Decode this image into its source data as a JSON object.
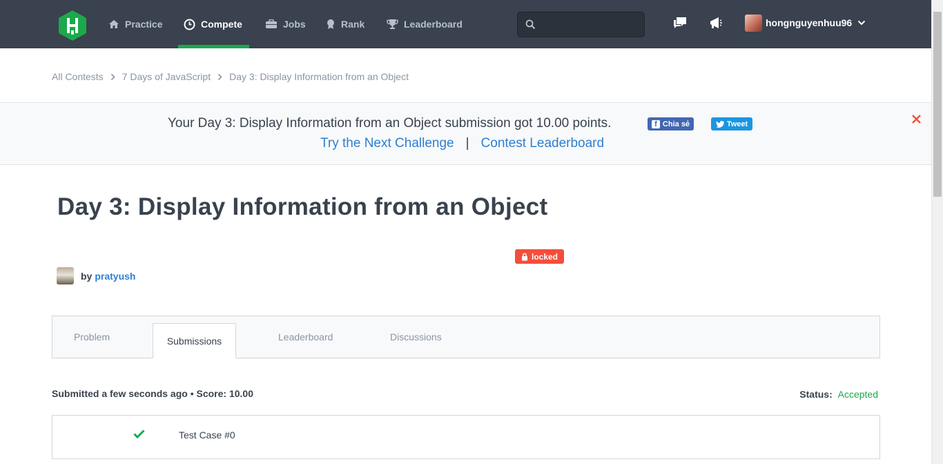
{
  "nav": {
    "items": [
      {
        "label": "Practice",
        "icon": "home-icon"
      },
      {
        "label": "Compete",
        "icon": "clock-icon"
      },
      {
        "label": "Jobs",
        "icon": "briefcase-icon"
      },
      {
        "label": "Rank",
        "icon": "medal-icon"
      },
      {
        "label": "Leaderboard",
        "icon": "trophy-icon"
      }
    ],
    "active": "Compete",
    "search_value": "",
    "username": "hongnguyenhuu96"
  },
  "breadcrumb": [
    "All Contests",
    "7 Days of JavaScript",
    "Day 3: Display Information from an Object"
  ],
  "banner": {
    "message": "Your Day 3: Display Information from an Object submission got 10.00 points.",
    "facebook_label": "Chia sẻ",
    "tweet_label": "Tweet",
    "next_link": "Try the Next Challenge",
    "separator": "|",
    "leaderboard_link": "Contest Leaderboard"
  },
  "challenge": {
    "title": "Day 3: Display Information from an Object",
    "badge": "locked",
    "by": "by",
    "author": "pratyush"
  },
  "tabs": [
    {
      "label": "Problem"
    },
    {
      "label": "Submissions"
    },
    {
      "label": "Leaderboard"
    },
    {
      "label": "Discussions"
    }
  ],
  "active_tab": "Submissions",
  "submission": {
    "info": "Submitted a few seconds ago • Score: 10.00",
    "status_label": "Status:",
    "status_value": "Accepted",
    "test_cases": [
      {
        "label": "Test Case #0",
        "passed": true
      }
    ]
  },
  "colors": {
    "nav_bg": "#39424e",
    "accent_green": "#1ba94c",
    "link_blue": "#2d7fd3",
    "locked_red": "#f34e3c"
  }
}
